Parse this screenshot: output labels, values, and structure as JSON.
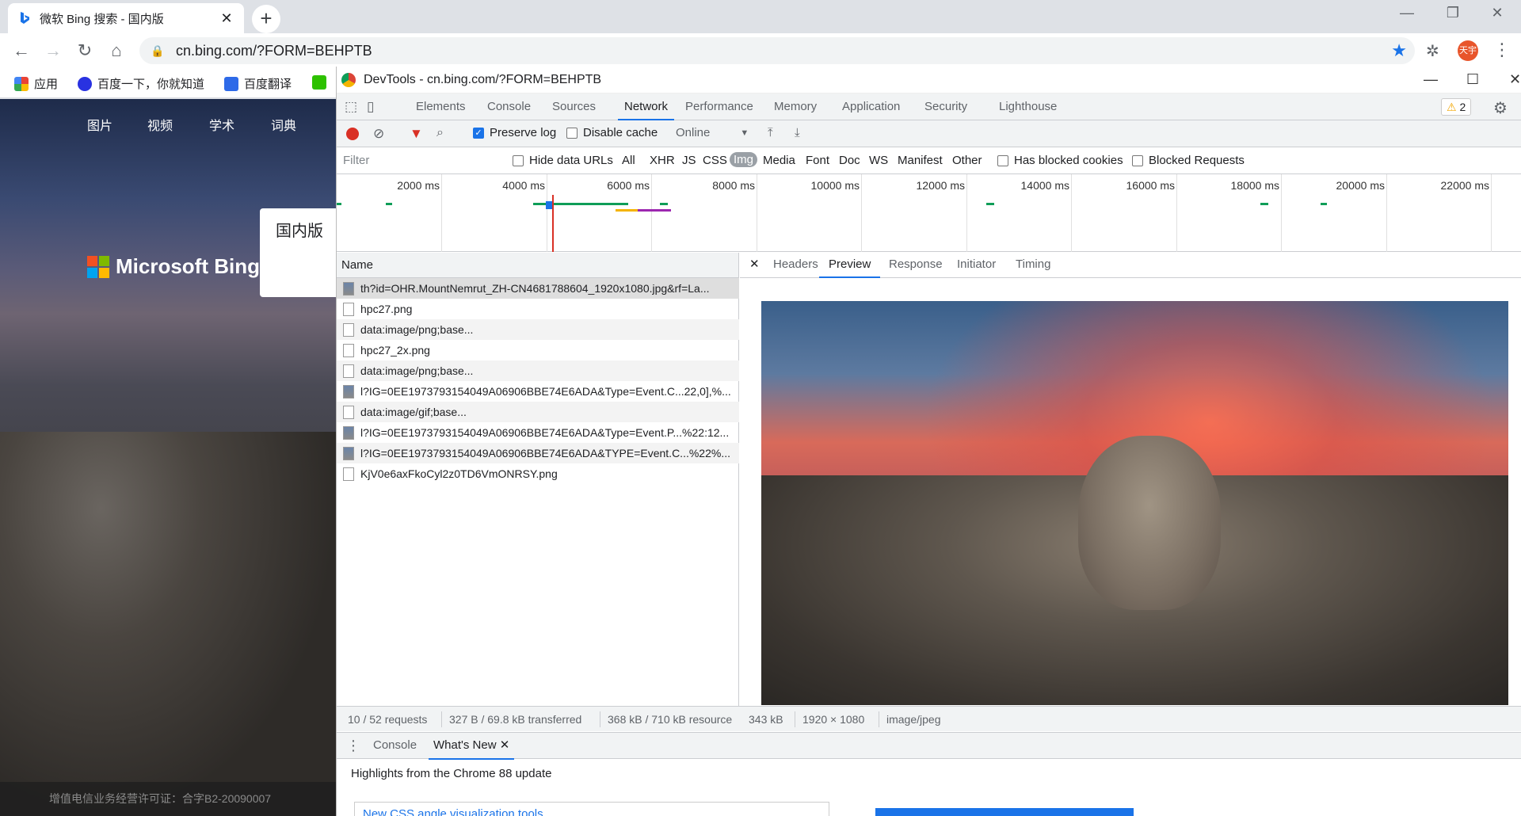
{
  "browser": {
    "tab_title": "微软 Bing 搜索 - 国内版",
    "url": "cn.bing.com/?FORM=BEHPTB",
    "profile_label": "天宇",
    "bookmarks": [
      "应用",
      "百度一下，你就知道",
      "百度翻译"
    ]
  },
  "page": {
    "nav": [
      "图片",
      "视频",
      "学术",
      "词典"
    ],
    "logo_text": "Microsoft Bing",
    "region_tab": "国内版",
    "footer_text": "增值电信业务经营许可证：合字B2-20090007"
  },
  "devtools": {
    "title": "DevTools - cn.bing.com/?FORM=BEHPTB",
    "tabs": [
      "Elements",
      "Console",
      "Sources",
      "Network",
      "Performance",
      "Memory",
      "Application",
      "Security",
      "Lighthouse"
    ],
    "active_tab": "Network",
    "warning_count": "2",
    "toolbar": {
      "preserve_log": "Preserve log",
      "disable_cache": "Disable cache",
      "throttle": "Online"
    },
    "filter": {
      "placeholder": "Filter",
      "hide_data_urls": "Hide data URLs",
      "types": [
        "All",
        "XHR",
        "JS",
        "CSS",
        "Img",
        "Media",
        "Font",
        "Doc",
        "WS",
        "Manifest",
        "Other"
      ],
      "active_type": "Img",
      "has_blocked_cookies": "Has blocked cookies",
      "blocked_requests": "Blocked Requests"
    },
    "timeline_ticks": [
      "2000 ms",
      "4000 ms",
      "6000 ms",
      "8000 ms",
      "10000 ms",
      "12000 ms",
      "14000 ms",
      "16000 ms",
      "18000 ms",
      "20000 ms",
      "22000 ms"
    ],
    "name_header": "Name",
    "requests": [
      "th?id=OHR.MountNemrut_ZH-CN4681788604_1920x1080.jpg&rf=La...",
      "hpc27.png",
      "data:image/png;base...",
      "hpc27_2x.png",
      "data:image/png;base...",
      "l?IG=0EE1973793154049A06906BBE74E6ADA&Type=Event.C...22,0],%...",
      "data:image/gif;base...",
      "l?IG=0EE1973793154049A06906BBE74E6ADA&Type=Event.P...%22:12...",
      "l?IG=0EE1973793154049A06906BBE74E6ADA&TYPE=Event.C...%22%...",
      "KjV0e6axFkoCyl2z0TD6VmONRSY.png"
    ],
    "preview_tabs": [
      "Headers",
      "Preview",
      "Response",
      "Initiator",
      "Timing"
    ],
    "active_preview_tab": "Preview",
    "summary": {
      "requests": "10 / 52 requests",
      "transferred": "327 B / 69.8 kB transferred",
      "resources": "368 kB / 710 kB resource",
      "size": "343 kB",
      "dimensions": "1920 × 1080",
      "mime": "image/jpeg"
    },
    "drawer": {
      "tabs": [
        "Console",
        "What's New"
      ],
      "active": "What's New",
      "highlights": "Highlights from the Chrome 88 update",
      "card_title": "New CSS angle visualization tools"
    }
  }
}
